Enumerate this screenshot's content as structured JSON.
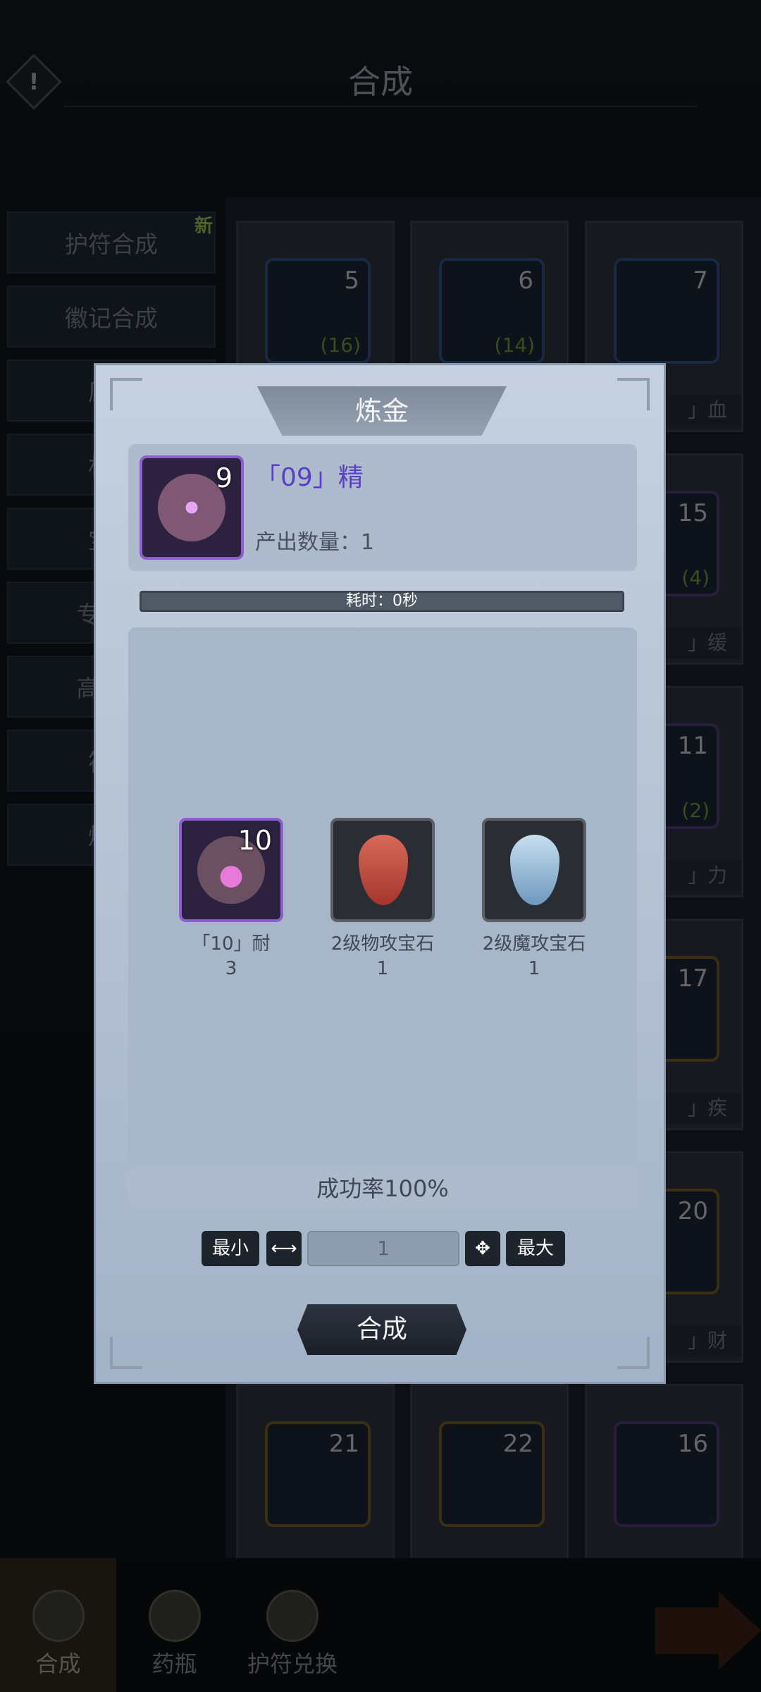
{
  "header": {
    "title": "合成",
    "warning_icon": "!"
  },
  "tabs": [
    {
      "label": "护符合成",
      "badge": "新"
    },
    {
      "label": "徽记合成"
    },
    {
      "label": "原料"
    },
    {
      "label": "材料"
    },
    {
      "label": "宝石"
    },
    {
      "label": "专属宝"
    },
    {
      "label": "高级护"
    },
    {
      "label": "符文"
    },
    {
      "label": "炼金"
    }
  ],
  "grid": [
    {
      "num": "5",
      "count": "(16)",
      "name": "",
      "frame": "blue"
    },
    {
      "num": "6",
      "count": "(14)",
      "name": "",
      "frame": "blue"
    },
    {
      "num": "7",
      "count": "",
      "name": "」血",
      "frame": "blue"
    },
    {
      "num": "15",
      "count": "(4)",
      "name": "」缓",
      "frame": "purple"
    },
    {
      "num": "11",
      "count": "(2)",
      "name": "」力",
      "frame": "purple"
    },
    {
      "num": "17",
      "count": "",
      "name": "」疾",
      "frame": "gold"
    },
    {
      "num": "20",
      "count": "",
      "name": "」财",
      "frame": "gold"
    },
    {
      "num": "21",
      "count": "",
      "name": "",
      "frame": "gold"
    },
    {
      "num": "22",
      "count": "",
      "name": "",
      "frame": "gold"
    },
    {
      "num": "16",
      "count": "",
      "name": "",
      "frame": "purple"
    }
  ],
  "bottom_nav": [
    {
      "label": "合成",
      "active": true,
      "icon": "compose-icon"
    },
    {
      "label": "药瓶",
      "icon": "potion-icon"
    },
    {
      "label": "护符兑换",
      "icon": "chest-icon"
    }
  ],
  "dialog": {
    "title": "炼金",
    "product": {
      "num": "9",
      "name": "「09」精",
      "output": "产出数量：1",
      "icon": "eye-gem-icon"
    },
    "time_label": "耗时：0秒",
    "time_progress": 1.0,
    "materials": [
      {
        "num": "10",
        "name": "「10」耐",
        "qty": "3",
        "icon": "rock-rune-icon"
      },
      {
        "name": "2级物攻宝石",
        "qty": "1",
        "icon": "red-drop-gem-icon"
      },
      {
        "name": "2级魔攻宝石",
        "qty": "1",
        "icon": "blue-drop-gem-icon"
      }
    ],
    "success_rate": "成功率100%",
    "qty": {
      "min_label": "最小",
      "max_label": "最大",
      "value": "1",
      "decrease_icon": "⟷",
      "increase_icon": "✥"
    },
    "craft_label": "合成"
  },
  "colors": {
    "accent_purple": "#8b5fd0",
    "product_name": "#5a3fc4",
    "new_badge": "#8fb14a"
  }
}
